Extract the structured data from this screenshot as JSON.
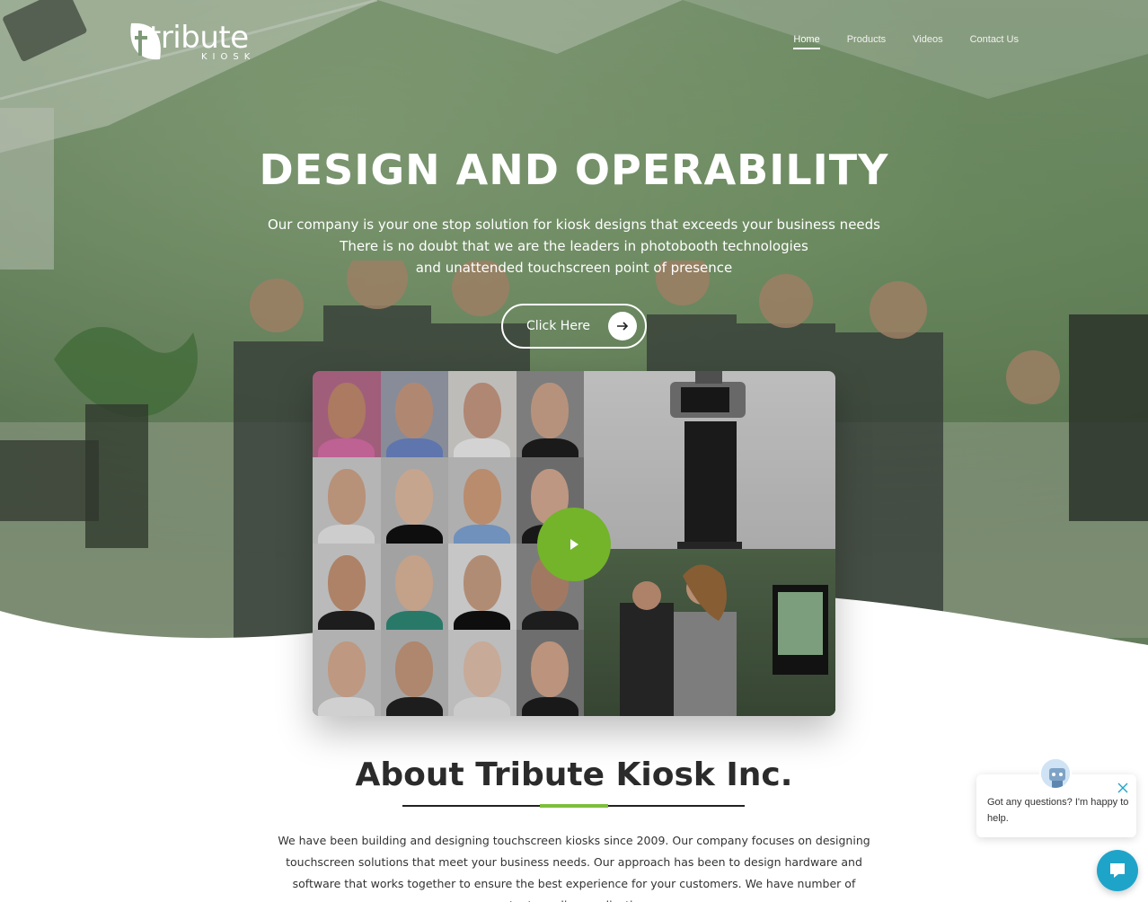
{
  "header": {
    "logo_text": "tribute",
    "logo_sub": "KIOSK",
    "nav": [
      {
        "label": "Home",
        "active": true
      },
      {
        "label": "Products",
        "active": false
      },
      {
        "label": "Videos",
        "active": false
      },
      {
        "label": "Contact Us",
        "active": false
      }
    ]
  },
  "hero": {
    "title": "DESIGN AND OPERABILITY",
    "lines": [
      "Our company is your one stop solution for kiosk designs that exceeds your business needs",
      "There is no doubt that we are the leaders in photobooth technologies",
      "and unattended touchscreen point of presence"
    ],
    "cta_label": "Click Here",
    "cta_icon": "arrow-right-icon"
  },
  "video": {
    "play_icon": "play-icon",
    "accent_color": "#73b42b"
  },
  "about": {
    "title": "About Tribute Kiosk Inc.",
    "body": "We have been building and designing touchscreen kiosks since 2009. Our company focuses on designing touchscreen solutions that meet your business needs. Our approach has been to design hardware and software that works together to ensure the best experience for your customers. We have number of patent pending applications",
    "accent_color": "#7cbf3a"
  },
  "chat": {
    "message": "Got any questions? I'm happy to help.",
    "launcher_color": "#1fa4c9",
    "close_icon": "close-icon",
    "launcher_icon": "chat-bubble-icon"
  }
}
